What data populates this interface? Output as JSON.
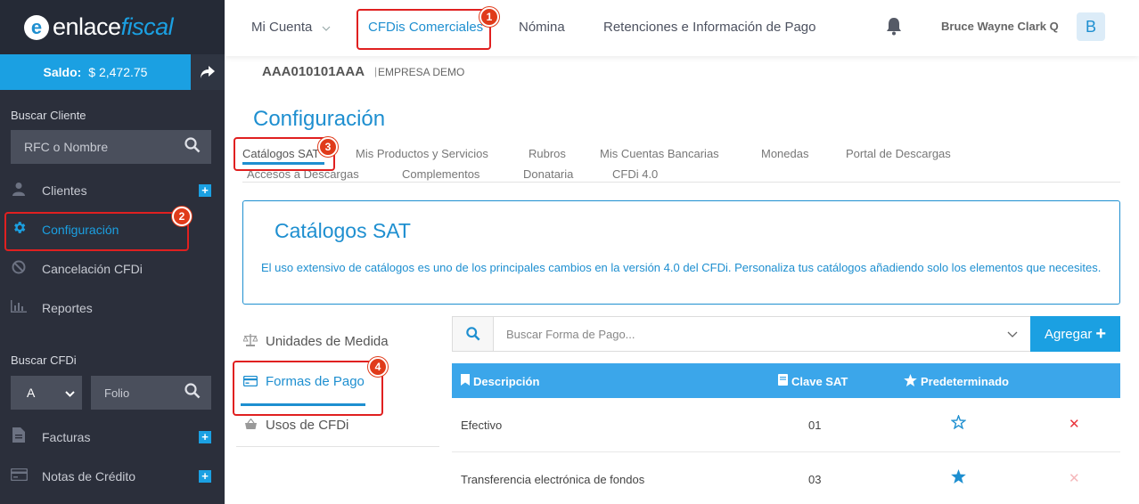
{
  "sidebar": {
    "logo_main": "enlace",
    "logo_accent": "fiscal",
    "saldo_label": "Saldo:",
    "saldo_value": "$ 2,472.75",
    "search_client_heading": "Buscar Cliente",
    "search_client_placeholder": "RFC o Nombre",
    "items": [
      {
        "label": "Clientes",
        "icon": "user-icon"
      },
      {
        "label": "Configuración",
        "icon": "gear-icon"
      },
      {
        "label": "Cancelación CFDi",
        "icon": "ban-icon"
      },
      {
        "label": "Reportes",
        "icon": "bar-chart-icon"
      }
    ],
    "search_cfdi_heading": "Buscar CFDi",
    "cfdi_series": "A",
    "folio_placeholder": "Folio",
    "items2": [
      {
        "label": "Facturas",
        "icon": "document-icon"
      },
      {
        "label": "Notas de Crédito",
        "icon": "credit-card-icon"
      }
    ]
  },
  "topnav": {
    "items": [
      "Mi Cuenta",
      "CFDis Comerciales",
      "Nómina",
      "Retenciones e Información de Pago"
    ],
    "user_name": "Bruce Wayne Clark Q",
    "avatar_letter": "B"
  },
  "main": {
    "rfc": "AAA010101AAA",
    "separator": "|",
    "company": "EMPRESA DEMO",
    "title": "Configuración",
    "subtabs_row1": [
      "Catálogos SAT",
      "Mis Productos y Servicios",
      "Rubros",
      "Mis Cuentas Bancarias",
      "Monedas",
      "Portal de Descargas"
    ],
    "subtabs_row2": [
      "Accesos a Descargas",
      "Complementos",
      "Donataria",
      "CFDi 4.0"
    ],
    "info_title": "Catálogos SAT",
    "info_text": "El uso extensivo de catálogos es uno de los principales cambios en la versión 4.0 del CFDi. Personaliza tus catálogos añadiendo solo los elementos que necesites.",
    "catalog_items": [
      {
        "label": "Unidades de Medida",
        "icon": "scale-icon"
      },
      {
        "label": "Formas de Pago",
        "icon": "credit-card-icon"
      },
      {
        "label": "Usos de CFDi",
        "icon": "basket-icon"
      }
    ],
    "search_placeholder": "Buscar Forma de Pago...",
    "add_label": "Agregar",
    "table": {
      "headers": [
        "Descripción",
        "Clave SAT",
        "Predeterminado"
      ],
      "rows": [
        {
          "descripcion": "Efectivo",
          "clave": "01",
          "predeterminado": false
        },
        {
          "descripcion": "Transferencia electrónica de fondos",
          "clave": "03",
          "predeterminado": true
        }
      ]
    }
  },
  "annotations": [
    "1",
    "2",
    "3",
    "4"
  ]
}
